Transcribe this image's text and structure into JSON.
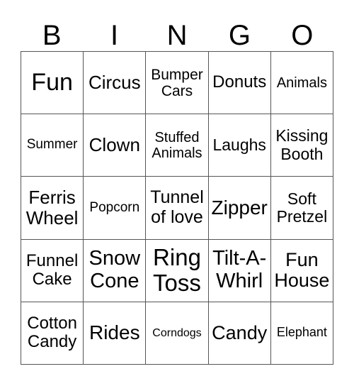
{
  "header": [
    "B",
    "I",
    "N",
    "G",
    "O"
  ],
  "cells": [
    [
      "Fun",
      "Circus",
      "Bumper\nCars",
      "Donuts",
      "Animals"
    ],
    [
      "Summer",
      "Clown",
      "Stuffed\nAnimals",
      "Laughs",
      "Kissing\nBooth"
    ],
    [
      "Ferris\nWheel",
      "Popcorn",
      "Tunnel\nof love",
      "Zipper",
      "Soft\nPretzel"
    ],
    [
      "Funnel\nCake",
      "Snow\nCone",
      "Ring\nToss",
      "Tilt-A-\nWhirl",
      "Fun\nHouse"
    ],
    [
      "Cotton\nCandy",
      "Rides",
      "Corndogs",
      "Candy",
      "Elephant"
    ]
  ]
}
